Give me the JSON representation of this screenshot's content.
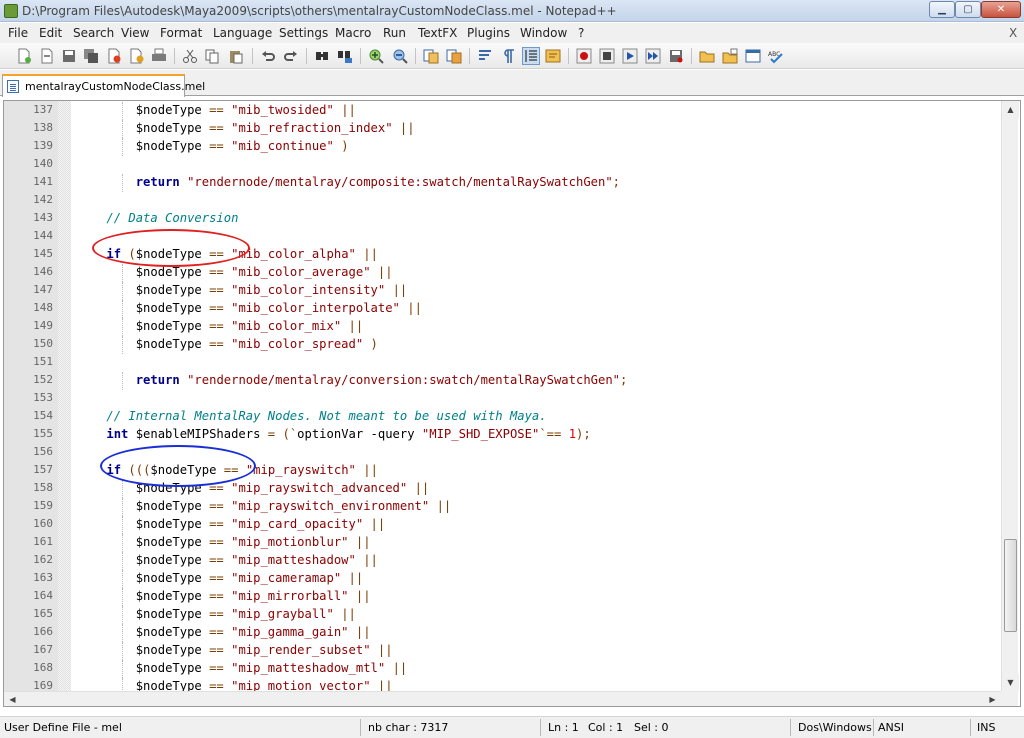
{
  "window": {
    "title": "D:\\Program Files\\Autodesk\\Maya2009\\scripts\\others\\mentalrayCustomNodeClass.mel - Notepad++",
    "minimize_glyph": "▁",
    "maximize_glyph": "▢",
    "close_glyph": "✕"
  },
  "menu": {
    "items": [
      "File",
      "Edit",
      "Search",
      "View",
      "Format",
      "Language",
      "Settings",
      "Macro",
      "Run",
      "TextFX",
      "Plugins",
      "Window",
      "?"
    ],
    "close_doc": "X"
  },
  "toolbar": {
    "icons": [
      "new-file",
      "open-file",
      "save",
      "save-all",
      "close",
      "close-all",
      "print",
      "cut",
      "copy",
      "paste",
      "undo",
      "redo",
      "find",
      "replace",
      "zoom-in",
      "zoom-out",
      "sync-vertical",
      "sync-horizontal",
      "word-wrap",
      "show-all-chars",
      "indent-guide",
      "user-define-lang",
      "record-macro",
      "stop-record",
      "play-macro",
      "run-macro-multiple",
      "save-macro",
      "open-folder",
      "fold-all",
      "launch-browser",
      "run-command",
      "spell-check"
    ]
  },
  "tab": {
    "label": "mentalrayCustomNodeClass.mel"
  },
  "editor": {
    "lines": [
      {
        "n": "137",
        "code": "$nodeType == \"mib_twosided\" ||"
      },
      {
        "n": "138",
        "code": "$nodeType == \"mib_refraction_index\" ||"
      },
      {
        "n": "139",
        "code": "$nodeType == \"mib_continue\" )"
      },
      {
        "n": "140",
        "code": ""
      },
      {
        "n": "141",
        "code": "return \"rendernode/mentalray/composite:swatch/mentalRaySwatchGen\";"
      },
      {
        "n": "142",
        "code": ""
      },
      {
        "n": "143",
        "code": "// Data Conversion"
      },
      {
        "n": "144",
        "code": ""
      },
      {
        "n": "145",
        "code": "if ($nodeType == \"mib_color_alpha\" ||"
      },
      {
        "n": "146",
        "code": "$nodeType == \"mib_color_average\" ||"
      },
      {
        "n": "147",
        "code": "$nodeType == \"mib_color_intensity\" ||"
      },
      {
        "n": "148",
        "code": "$nodeType == \"mib_color_interpolate\" ||"
      },
      {
        "n": "149",
        "code": "$nodeType == \"mib_color_mix\" ||"
      },
      {
        "n": "150",
        "code": "$nodeType == \"mib_color_spread\" )"
      },
      {
        "n": "151",
        "code": ""
      },
      {
        "n": "152",
        "code": "return \"rendernode/mentalray/conversion:swatch/mentalRaySwatchGen\";"
      },
      {
        "n": "153",
        "code": ""
      },
      {
        "n": "154",
        "code": "// Internal MentalRay Nodes. Not meant to be used with Maya."
      },
      {
        "n": "155",
        "code": "int $enableMIPShaders = (`optionVar -query \"MIP_SHD_EXPOSE\"`== 1);"
      },
      {
        "n": "156",
        "code": ""
      },
      {
        "n": "157",
        "code": "if ((($nodeType == \"mip_rayswitch\" ||"
      },
      {
        "n": "158",
        "code": "$nodeType == \"mip_rayswitch_advanced\" ||"
      },
      {
        "n": "159",
        "code": "$nodeType == \"mip_rayswitch_environment\" ||"
      },
      {
        "n": "160",
        "code": "$nodeType == \"mip_card_opacity\" ||"
      },
      {
        "n": "161",
        "code": "$nodeType == \"mip_motionblur\" ||"
      },
      {
        "n": "162",
        "code": "$nodeType == \"mip_matteshadow\" ||"
      },
      {
        "n": "163",
        "code": "$nodeType == \"mip_cameramap\" ||"
      },
      {
        "n": "164",
        "code": "$nodeType == \"mip_mirrorball\" ||"
      },
      {
        "n": "165",
        "code": "$nodeType == \"mip_grayball\" ||"
      },
      {
        "n": "166",
        "code": "$nodeType == \"mip_gamma_gain\" ||"
      },
      {
        "n": "167",
        "code": "$nodeType == \"mip_render_subset\" ||"
      },
      {
        "n": "168",
        "code": "$nodeType == \"mip_matteshadow_mtl\" ||"
      },
      {
        "n": "169",
        "code": "$nodeType == \"mip_motion_vector\" ||"
      }
    ],
    "annotations": {
      "red_ellipse_color": "#e02020",
      "blue_ellipse_color": "#1a2ed6"
    }
  },
  "statusbar": {
    "language": "User Define File - mel",
    "length": "nb char : 7317",
    "line": "Ln : 1",
    "col": "Col : 1",
    "sel": "Sel : 0",
    "eol": "Dos\\Windows",
    "encoding": "ANSI",
    "mode": "INS"
  }
}
